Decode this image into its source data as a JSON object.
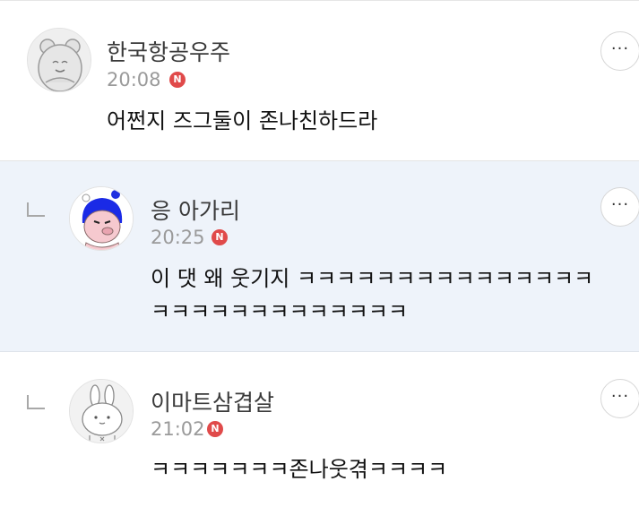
{
  "comments": [
    {
      "author": "한국항공우주",
      "time": "20:08",
      "badge": "N",
      "lines": [
        "어쩐지 즈그둘이 존나친하드라"
      ],
      "avatar_icon": "bear-avatar-icon",
      "more_label": "···"
    },
    {
      "author": "응 아가리",
      "time": "20:25",
      "badge": "N",
      "lines": [
        "이 댓 왜 웃기지 ㅋㅋㅋㅋㅋㅋㅋㅋㅋㅋㅋㅋㅋㅋㅋ",
        "ㅋㅋㅋㅋㅋㅋㅋㅋㅋㅋㅋㅋㅋ"
      ],
      "avatar_icon": "pig-character-avatar-icon",
      "more_label": "···",
      "is_reply": true
    },
    {
      "author": "이마트삼겹살",
      "time": "21:02",
      "badge": "N",
      "lines": [
        "ㅋㅋㅋㅋㅋㅋㅋ존나웃겪ㅋㅋㅋㅋ"
      ],
      "avatar_icon": "rabbit-avatar-icon",
      "more_label": "···",
      "is_reply": true
    }
  ],
  "colors": {
    "highlight_bg": "#eef3fa",
    "badge": "#e04a4a",
    "time_text": "#9a9a9a"
  }
}
